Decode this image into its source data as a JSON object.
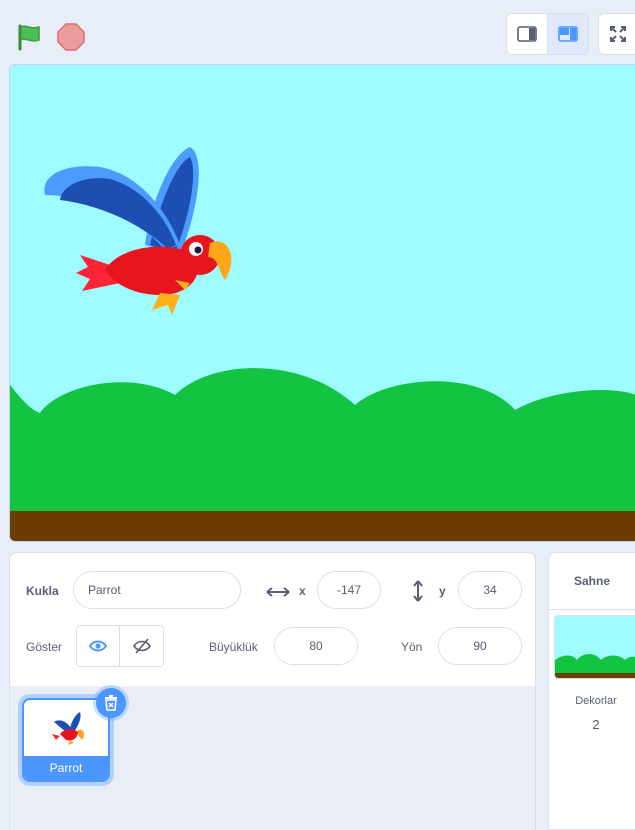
{
  "toolbar": {
    "green_flag_icon": "green-flag-icon",
    "stop_icon": "stop-icon",
    "small_stage_icon": "small-stage-icon",
    "normal_stage_icon": "normal-stage-icon",
    "fullscreen_icon": "fullscreen-icon"
  },
  "sprite_info": {
    "sprite_label": "Kukla",
    "sprite_name": "Parrot",
    "x_label": "x",
    "x_value": "-147",
    "y_label": "y",
    "y_value": "34",
    "show_label": "Göster",
    "size_label": "Büyüklük",
    "size_value": "80",
    "direction_label": "Yön",
    "direction_value": "90"
  },
  "sprites": [
    {
      "name": "Parrot"
    }
  ],
  "stage_pane": {
    "header": "Sahne",
    "backdrops_label": "Dekorlar",
    "backdrops_count": "2"
  },
  "colors": {
    "accent": "#4c97ff",
    "sky": "#9efcff",
    "grass": "#13c442",
    "ground": "#6b3d00"
  }
}
